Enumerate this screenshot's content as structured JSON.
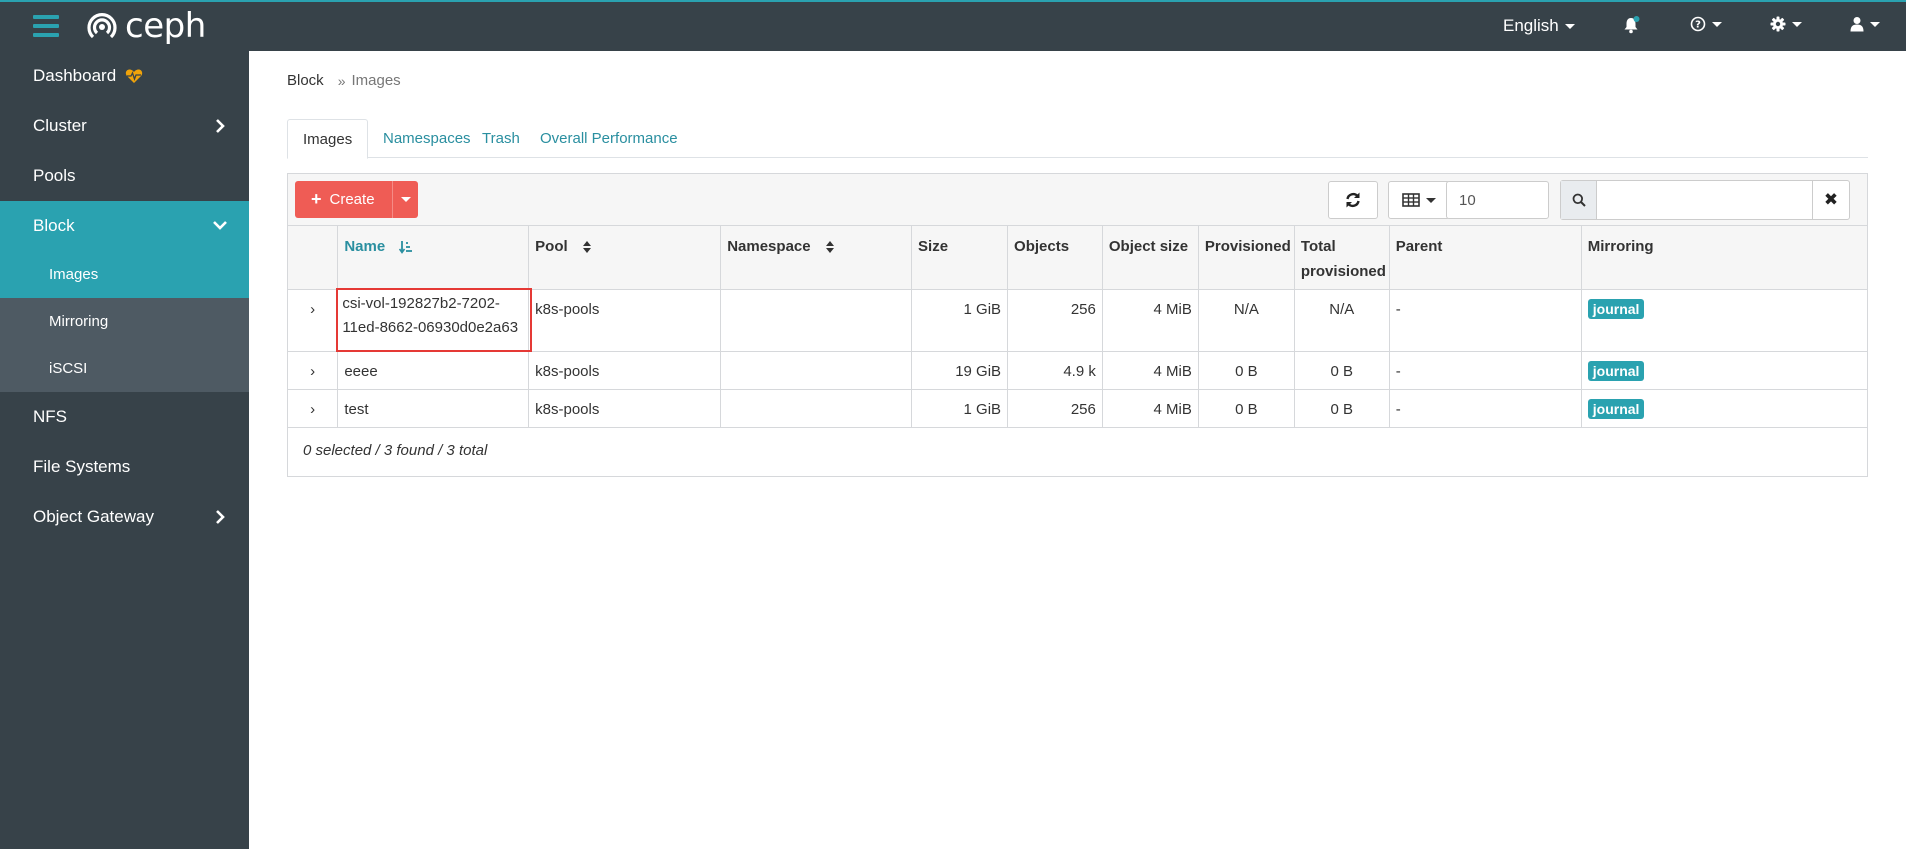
{
  "app": {
    "brand": "ceph",
    "language": "English"
  },
  "sidebar": {
    "items": [
      {
        "label": "Dashboard"
      },
      {
        "label": "Cluster"
      },
      {
        "label": "Pools"
      },
      {
        "label": "Block"
      },
      {
        "label": "NFS"
      },
      {
        "label": "File Systems"
      },
      {
        "label": "Object Gateway"
      }
    ],
    "block_sub": [
      {
        "label": "Images"
      },
      {
        "label": "Mirroring"
      },
      {
        "label": "iSCSI"
      }
    ]
  },
  "breadcrumb": {
    "parent": "Block",
    "current": "Images"
  },
  "tabs": [
    {
      "label": "Images"
    },
    {
      "label": "Namespaces"
    },
    {
      "label": "Trash"
    },
    {
      "label": "Overall Performance"
    }
  ],
  "toolbar": {
    "create_label": "Create",
    "page_size": "10",
    "search_placeholder": ""
  },
  "table": {
    "columns": [
      "Name",
      "Pool",
      "Namespace",
      "Size",
      "Objects",
      "Object size",
      "Provisioned",
      "Total provisioned",
      "Parent",
      "Mirroring"
    ],
    "rows": [
      {
        "name": "csi-vol-192827b2-7202-11ed-8662-06930d0e2a63",
        "pool": "k8s-pools",
        "namespace": "",
        "size": "1 GiB",
        "objects": "256",
        "object_size": "4 MiB",
        "provisioned": "N/A",
        "total_provisioned": "N/A",
        "parent": "-",
        "mirroring": "journal"
      },
      {
        "name": "eeee",
        "pool": "k8s-pools",
        "namespace": "",
        "size": "19 GiB",
        "objects": "4.9 k",
        "object_size": "4 MiB",
        "provisioned": "0 B",
        "total_provisioned": "0 B",
        "parent": "-",
        "mirroring": "journal"
      },
      {
        "name": "test",
        "pool": "k8s-pools",
        "namespace": "",
        "size": "1 GiB",
        "objects": "256",
        "object_size": "4 MiB",
        "provisioned": "0 B",
        "total_provisioned": "0 B",
        "parent": "-",
        "mirroring": "journal"
      }
    ],
    "footer": "0 selected / 3 found / 3 total"
  },
  "colors": {
    "navbar": "#374249",
    "accent": "#2aa2b0",
    "create": "#ef5c55",
    "highlight": "#e53935"
  }
}
